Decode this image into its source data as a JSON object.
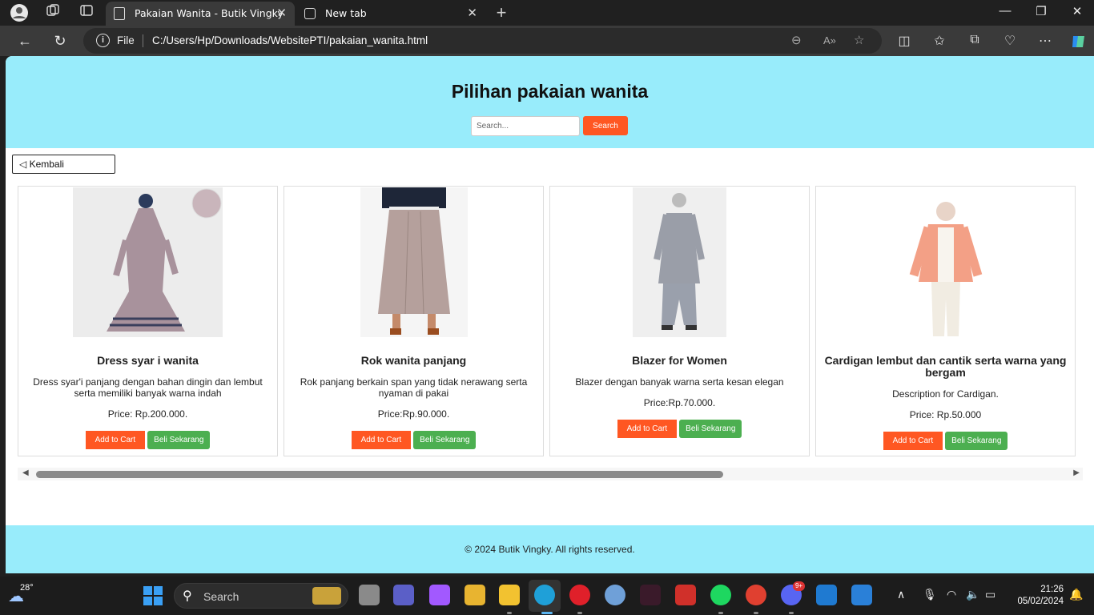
{
  "browser": {
    "tabs": [
      {
        "title": "Pakaian Wanita - Butik Vingky",
        "active": true
      },
      {
        "title": "New tab",
        "active": false
      }
    ],
    "address": {
      "scheme_label": "File",
      "url": "C:/Users/Hp/Downloads/WebsitePTI/pakaian_wanita.html"
    }
  },
  "page": {
    "title": "Pilihan pakaian wanita",
    "search": {
      "placeholder": "Search...",
      "button": "Search"
    },
    "back_button": "◁ Kembali",
    "products": [
      {
        "name": "Dress syar i wanita",
        "description": "Dress syar'i panjang dengan bahan dingin dan lembut serta memiliki banyak warna indah",
        "price": "Price: Rp.200.000.",
        "add_to_cart": "Add to Cart",
        "buy_now": "Beli Sekarang"
      },
      {
        "name": "Rok wanita panjang",
        "description": "Rok panjang berkain span yang tidak nerawang serta nyaman di pakai",
        "price": "Price:Rp.90.000.",
        "add_to_cart": "Add to Cart",
        "buy_now": "Beli Sekarang"
      },
      {
        "name": "Blazer for Women",
        "description": "Blazer dengan banyak warna serta kesan elegan",
        "price": "Price:Rp.70.000.",
        "add_to_cart": "Add to Cart",
        "buy_now": "Beli Sekarang"
      },
      {
        "name": "Cardigan lembut dan cantik serta warna yang bergam",
        "description": "Description for Cardigan.",
        "price": "Price: Rp.50.000",
        "add_to_cart": "Add to Cart",
        "buy_now": "Beli Sekarang"
      }
    ],
    "footer": "© 2024 Butik Vingky. All rights reserved."
  },
  "colors": {
    "header_bg": "#98ecfb",
    "accent_orange": "#ff5722",
    "accent_green": "#4caf50"
  },
  "taskbar": {
    "weather_temp": "28°",
    "search_label": "Search",
    "discord_badge": "9+",
    "time": "21:26",
    "date": "05/02/2024"
  }
}
